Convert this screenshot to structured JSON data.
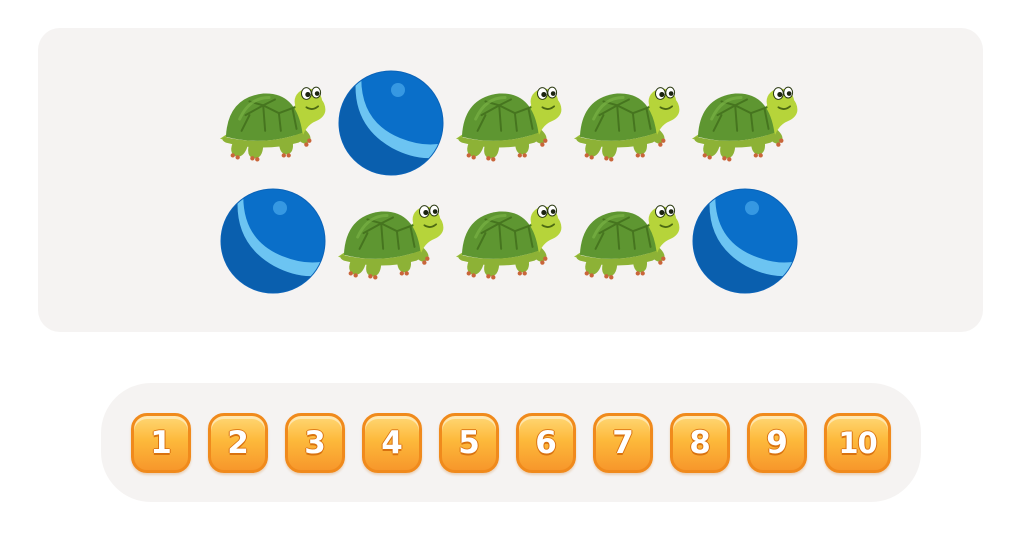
{
  "picture": {
    "rows": [
      [
        "turtle",
        "ball",
        "turtle",
        "turtle",
        "turtle"
      ],
      [
        "ball",
        "turtle",
        "turtle",
        "turtle",
        "ball"
      ]
    ],
    "icons": {
      "turtle": "turtle-icon",
      "ball": "ball-icon"
    }
  },
  "answers": [
    {
      "label": "1"
    },
    {
      "label": "2"
    },
    {
      "label": "3"
    },
    {
      "label": "4"
    },
    {
      "label": "5"
    },
    {
      "label": "6"
    },
    {
      "label": "7"
    },
    {
      "label": "8"
    },
    {
      "label": "9"
    },
    {
      "label": "10"
    }
  ],
  "colors": {
    "panel": "#f5f3f2",
    "button": "#fdb93b",
    "button_border": "#f08a1c",
    "turtle_shell": "#5e9631",
    "turtle_body": "#b6d43a",
    "ball_dark": "#0a6fc9",
    "ball_light": "#6cc4f2"
  }
}
